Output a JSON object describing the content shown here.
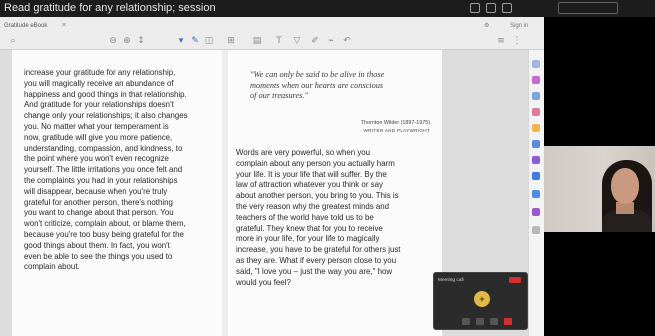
{
  "window": {
    "title": "Read gratitude for any relationship; session"
  },
  "chrome": {
    "tab_label": "Gratitude eBook",
    "tab_close": "×",
    "menu_label": "Sign in"
  },
  "toolbar": {
    "icons": [
      "search-icon",
      "zoom-out-icon",
      "zoom-in-icon",
      "page-nav-icon",
      "select-tool-icon",
      "annotate-icon",
      "view-icon",
      "highlight-icon",
      "text-icon",
      "draw-icon",
      "link-icon",
      "undo-icon"
    ]
  },
  "document": {
    "left_column": [
      "increase your gratitude for any relationship,",
      "you will magically receive an abundance of",
      "happiness and good things in that relationship.",
      "And gratitude for your relationships doesn't",
      "change only your relationships; it also changes",
      "you. No matter what your temperament is",
      "now, gratitude will give you more patience,",
      "understanding, compassion, and kindness, to",
      "the point where you won't even recognize",
      "yourself. The little irritations you once felt and",
      "the complaints you had in your relationships",
      "will disappear, because when you're truly",
      "grateful for another person, there's nothing",
      "you want to change about that person. You",
      "won't criticize, complain about, or blame them,",
      "because you're too busy being grateful for the",
      "good things about them. In fact, you won't",
      "even be able to see the things you used to",
      "complain about."
    ],
    "quote": {
      "lines": [
        "\"We can only be said to be alive in those",
        "moments when our hearts are conscious",
        "of our treasures.\""
      ],
      "author": "Thornton Wilder (1897-1975)",
      "author_role": "WRITER AND PLAYWRIGHT"
    },
    "right_column": [
      "Words are very powerful, so when you",
      "complain about any person you actually harm",
      "your life. It is your life that will suffer. By the",
      "law of attraction whatever you think or say",
      "about another person, you bring to you. This is",
      "the very reason why the greatest minds and",
      "teachers of the world have told us to be",
      "grateful. They knew that for you to receive",
      "more in your life, for your life to magically",
      "increase, you have to be grateful for others just",
      "as they are. What if every person close to you",
      "said, \"I love you – just the way you are,\" how",
      "would you feel?"
    ]
  },
  "call_widget": {
    "header": "Meeting call",
    "avatar_initial": "+"
  }
}
